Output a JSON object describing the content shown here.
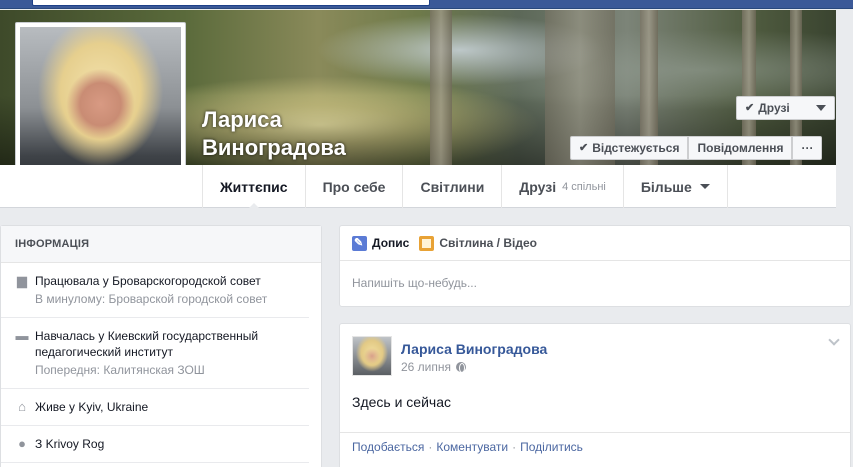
{
  "profile": {
    "name_line1": "Лариса",
    "name_line2": "Виноградова"
  },
  "cover_buttons": {
    "friends": "Друзі",
    "follow": "Відстежується",
    "message": "Повідомлення",
    "more": "···"
  },
  "tabs": [
    {
      "label": "Життєпис"
    },
    {
      "label": "Про себе"
    },
    {
      "label": "Світлини"
    },
    {
      "label": "Друзі",
      "sub": "4 спільні"
    },
    {
      "label": "Більше"
    }
  ],
  "info": {
    "header": "ІНФОРМАЦІЯ",
    "items": [
      {
        "icon": "briefcase-icon",
        "main_prefix": "Працювала у ",
        "main_link": "Броварскогородской совет",
        "sub": "В минулому: Броварской городской совет"
      },
      {
        "icon": "graduation-cap-icon",
        "main_prefix": "Навчалась у ",
        "main_link": "Киевский государственный педагогический институт",
        "sub": "Попередня: Калитянская ЗОШ"
      },
      {
        "icon": "home-icon",
        "main_prefix": "Живе у ",
        "main_link": "Kyiv, Ukraine",
        "sub": ""
      },
      {
        "icon": "location-pin-icon",
        "main_prefix": "З ",
        "main_link": "Krivoy Rog",
        "sub": ""
      }
    ]
  },
  "composer": {
    "status_label": "Допис",
    "photo_label": "Світлина / Відео",
    "placeholder": "Напишіть що-небудь..."
  },
  "post": {
    "author": "Лариса Виноградова",
    "date": "26 липня",
    "text": "Здесь и сейчас",
    "like": "Подобається",
    "comment": "Коментувати",
    "share": "Поділитись",
    "sep": "·"
  },
  "colors": {
    "brand": "#3b5998",
    "link": "#365899",
    "background": "#e9ebee"
  }
}
